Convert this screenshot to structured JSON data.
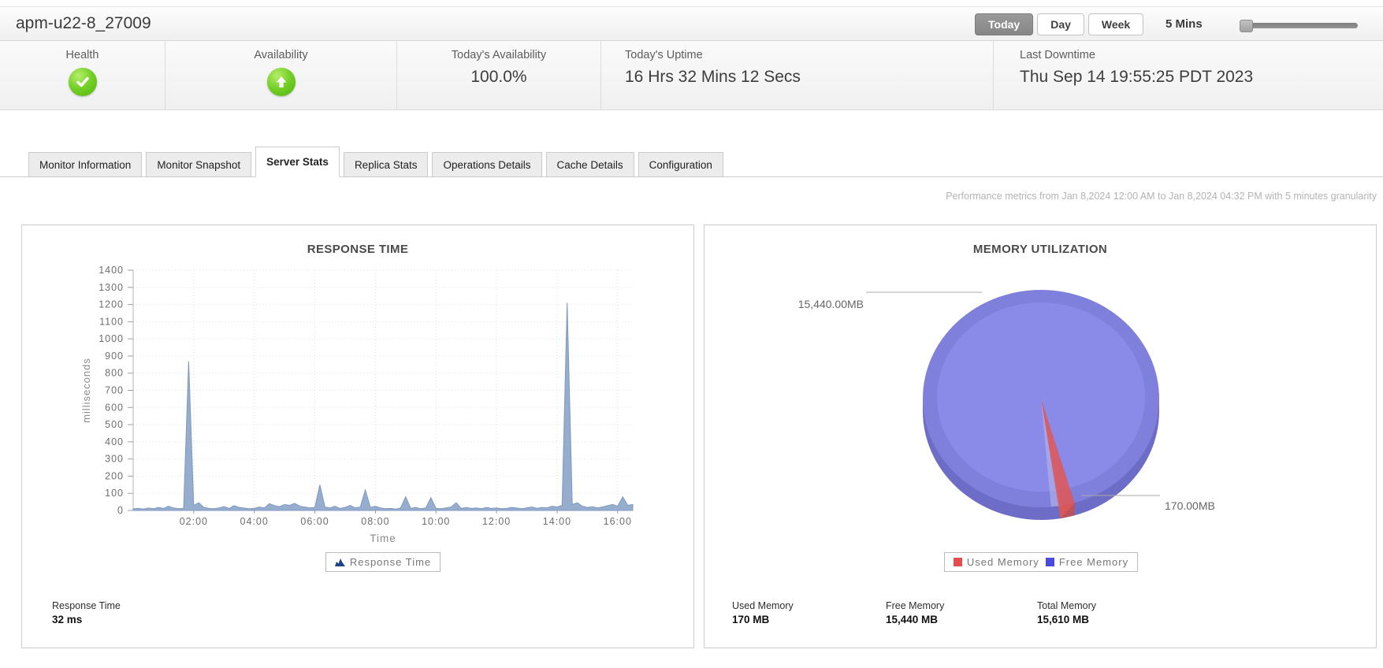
{
  "window": {
    "title": "apm-u22-8_27009"
  },
  "toolbar": {
    "period_buttons": [
      {
        "label": "Today",
        "active": true
      },
      {
        "label": "Day",
        "active": false
      },
      {
        "label": "Week",
        "active": false
      }
    ],
    "granularity_label": "5 Mins"
  },
  "status": {
    "health": {
      "label": "Health",
      "state": "ok"
    },
    "availability": {
      "label": "Availability",
      "state": "up"
    },
    "todays_availability": {
      "label": "Today's Availability",
      "value": "100.0%"
    },
    "todays_uptime": {
      "label": "Today's Uptime",
      "value": "16 Hrs 32 Mins 12 Secs"
    },
    "last_downtime": {
      "label": "Last Downtime",
      "value": "Thu Sep 14 19:55:25 PDT 2023"
    }
  },
  "tabs": [
    {
      "label": "Monitor Information",
      "active": false
    },
    {
      "label": "Monitor Snapshot",
      "active": false
    },
    {
      "label": "Server Stats",
      "active": true
    },
    {
      "label": "Replica Stats",
      "active": false
    },
    {
      "label": "Operations Details",
      "active": false
    },
    {
      "label": "Cache Details",
      "active": false
    },
    {
      "label": "Configuration",
      "active": false
    }
  ],
  "metrics_note": "Performance metrics from Jan 8,2024 12:00 AM to Jan 8,2024 04:32 PM with 5 minutes granularity",
  "response_panel": {
    "summary_label": "Response Time",
    "summary_value": "32 ms"
  },
  "memory_panel": {
    "summary": [
      {
        "label": "Used Memory",
        "value": "170 MB"
      },
      {
        "label": "Free Memory",
        "value": "15,440 MB"
      },
      {
        "label": "Total Memory",
        "value": "15,610 MB"
      }
    ]
  },
  "chart_data": [
    {
      "type": "area",
      "title": "RESPONSE TIME",
      "xlabel": "Time",
      "ylabel": "milliseconds",
      "ylim": [
        0,
        1400
      ],
      "ytick_step": 100,
      "x_start_min": 0,
      "x_step_min": 10,
      "xticks": [
        {
          "min": 120,
          "label": "02:00"
        },
        {
          "min": 240,
          "label": "04:00"
        },
        {
          "min": 360,
          "label": "06:00"
        },
        {
          "min": 480,
          "label": "08:00"
        },
        {
          "min": 600,
          "label": "10:00"
        },
        {
          "min": 720,
          "label": "12:00"
        },
        {
          "min": 840,
          "label": "14:00"
        },
        {
          "min": 960,
          "label": "16:00"
        }
      ],
      "values": [
        10,
        12,
        8,
        14,
        10,
        18,
        12,
        25,
        15,
        10,
        12,
        870,
        30,
        45,
        18,
        12,
        10,
        15,
        22,
        12,
        28,
        18,
        14,
        10,
        12,
        20,
        15,
        40,
        28,
        22,
        35,
        30,
        42,
        25,
        20,
        15,
        18,
        150,
        20,
        15,
        25,
        12,
        18,
        30,
        15,
        20,
        120,
        18,
        25,
        15,
        10,
        12,
        8,
        15,
        80,
        12,
        18,
        10,
        15,
        75,
        12,
        10,
        15,
        20,
        45,
        12,
        18,
        12,
        15,
        10,
        18,
        12,
        15,
        10,
        12,
        18,
        14,
        10,
        15,
        20,
        12,
        18,
        15,
        25,
        20,
        30,
        1210,
        35,
        45,
        25,
        18,
        22,
        15,
        20,
        28,
        35,
        25,
        80,
        30,
        35
      ],
      "legend": [
        {
          "label": "Response Time",
          "color": "#1c4587"
        }
      ],
      "series_fill": "#90a9cb",
      "series_edge": "#7e99c0",
      "grid": "dotted"
    },
    {
      "type": "pie",
      "title": "MEMORY UTILIZATION",
      "slices": [
        {
          "label": "Used Memory",
          "value_mb": 170,
          "display": "170.00MB",
          "color": "#e64c4c"
        },
        {
          "label": "Free Memory",
          "value_mb": 15440,
          "display": "15,440.00MB",
          "color": "#4a4ae0"
        }
      ],
      "pie_body_color": "#7f7fdc",
      "legend_position": "bottom"
    }
  ]
}
